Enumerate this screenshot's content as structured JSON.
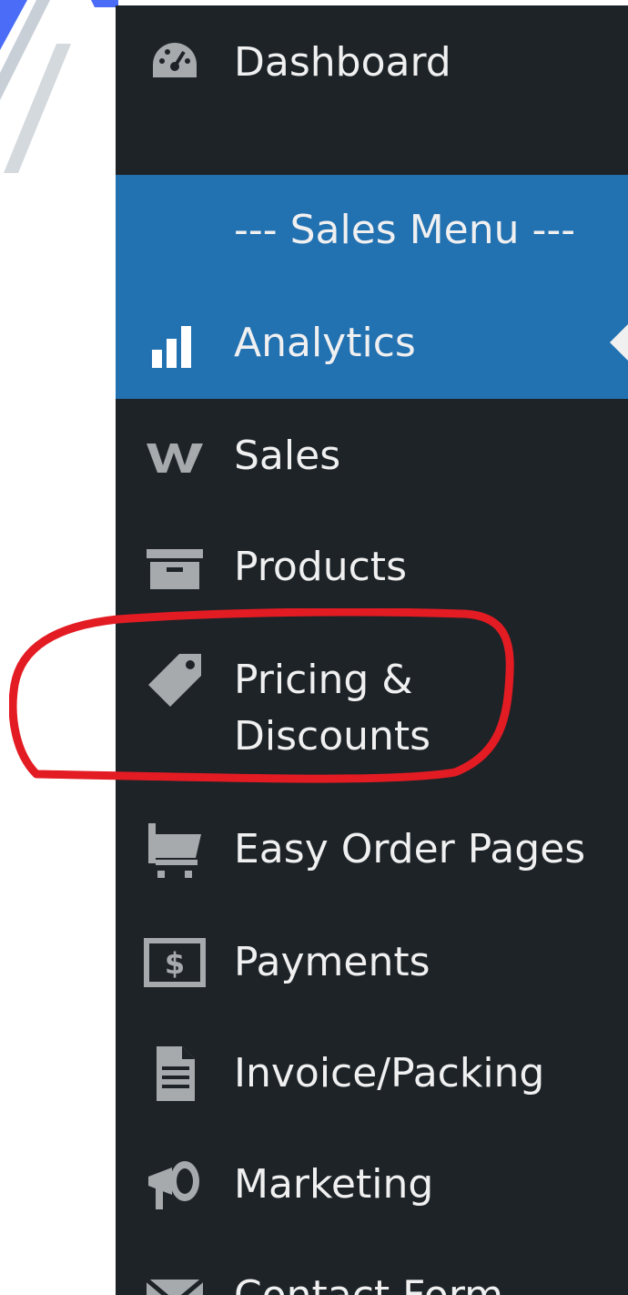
{
  "menu": {
    "dashboard": {
      "label": "Dashboard",
      "icon": "dashboard-gauge-icon"
    },
    "sales_menu_header": {
      "label": "--- Sales Menu ---"
    },
    "analytics": {
      "label": "Analytics",
      "icon": "bar-chart-icon"
    },
    "sales": {
      "label": "Sales",
      "icon": "woo-w-icon"
    },
    "products": {
      "label": "Products",
      "icon": "archive-box-icon"
    },
    "pricing": {
      "label_line1": "Pricing &",
      "label_line2": "Discounts",
      "icon": "price-tag-icon"
    },
    "easy_order": {
      "label": "Easy Order Pages",
      "icon": "shopping-cart-icon"
    },
    "payments": {
      "label": "Payments",
      "icon": "money-icon"
    },
    "invoice": {
      "label": "Invoice/Packing",
      "icon": "document-icon"
    },
    "marketing": {
      "label": "Marketing",
      "icon": "megaphone-icon"
    },
    "contact": {
      "label": "Contact Form",
      "icon": "envelope-icon"
    }
  },
  "colors": {
    "sidebar_bg": "#1d2327",
    "active_bg": "#2271b1",
    "text": "#f0f0f1",
    "icon": "#a7aaad",
    "highlight": "#e31b23"
  }
}
